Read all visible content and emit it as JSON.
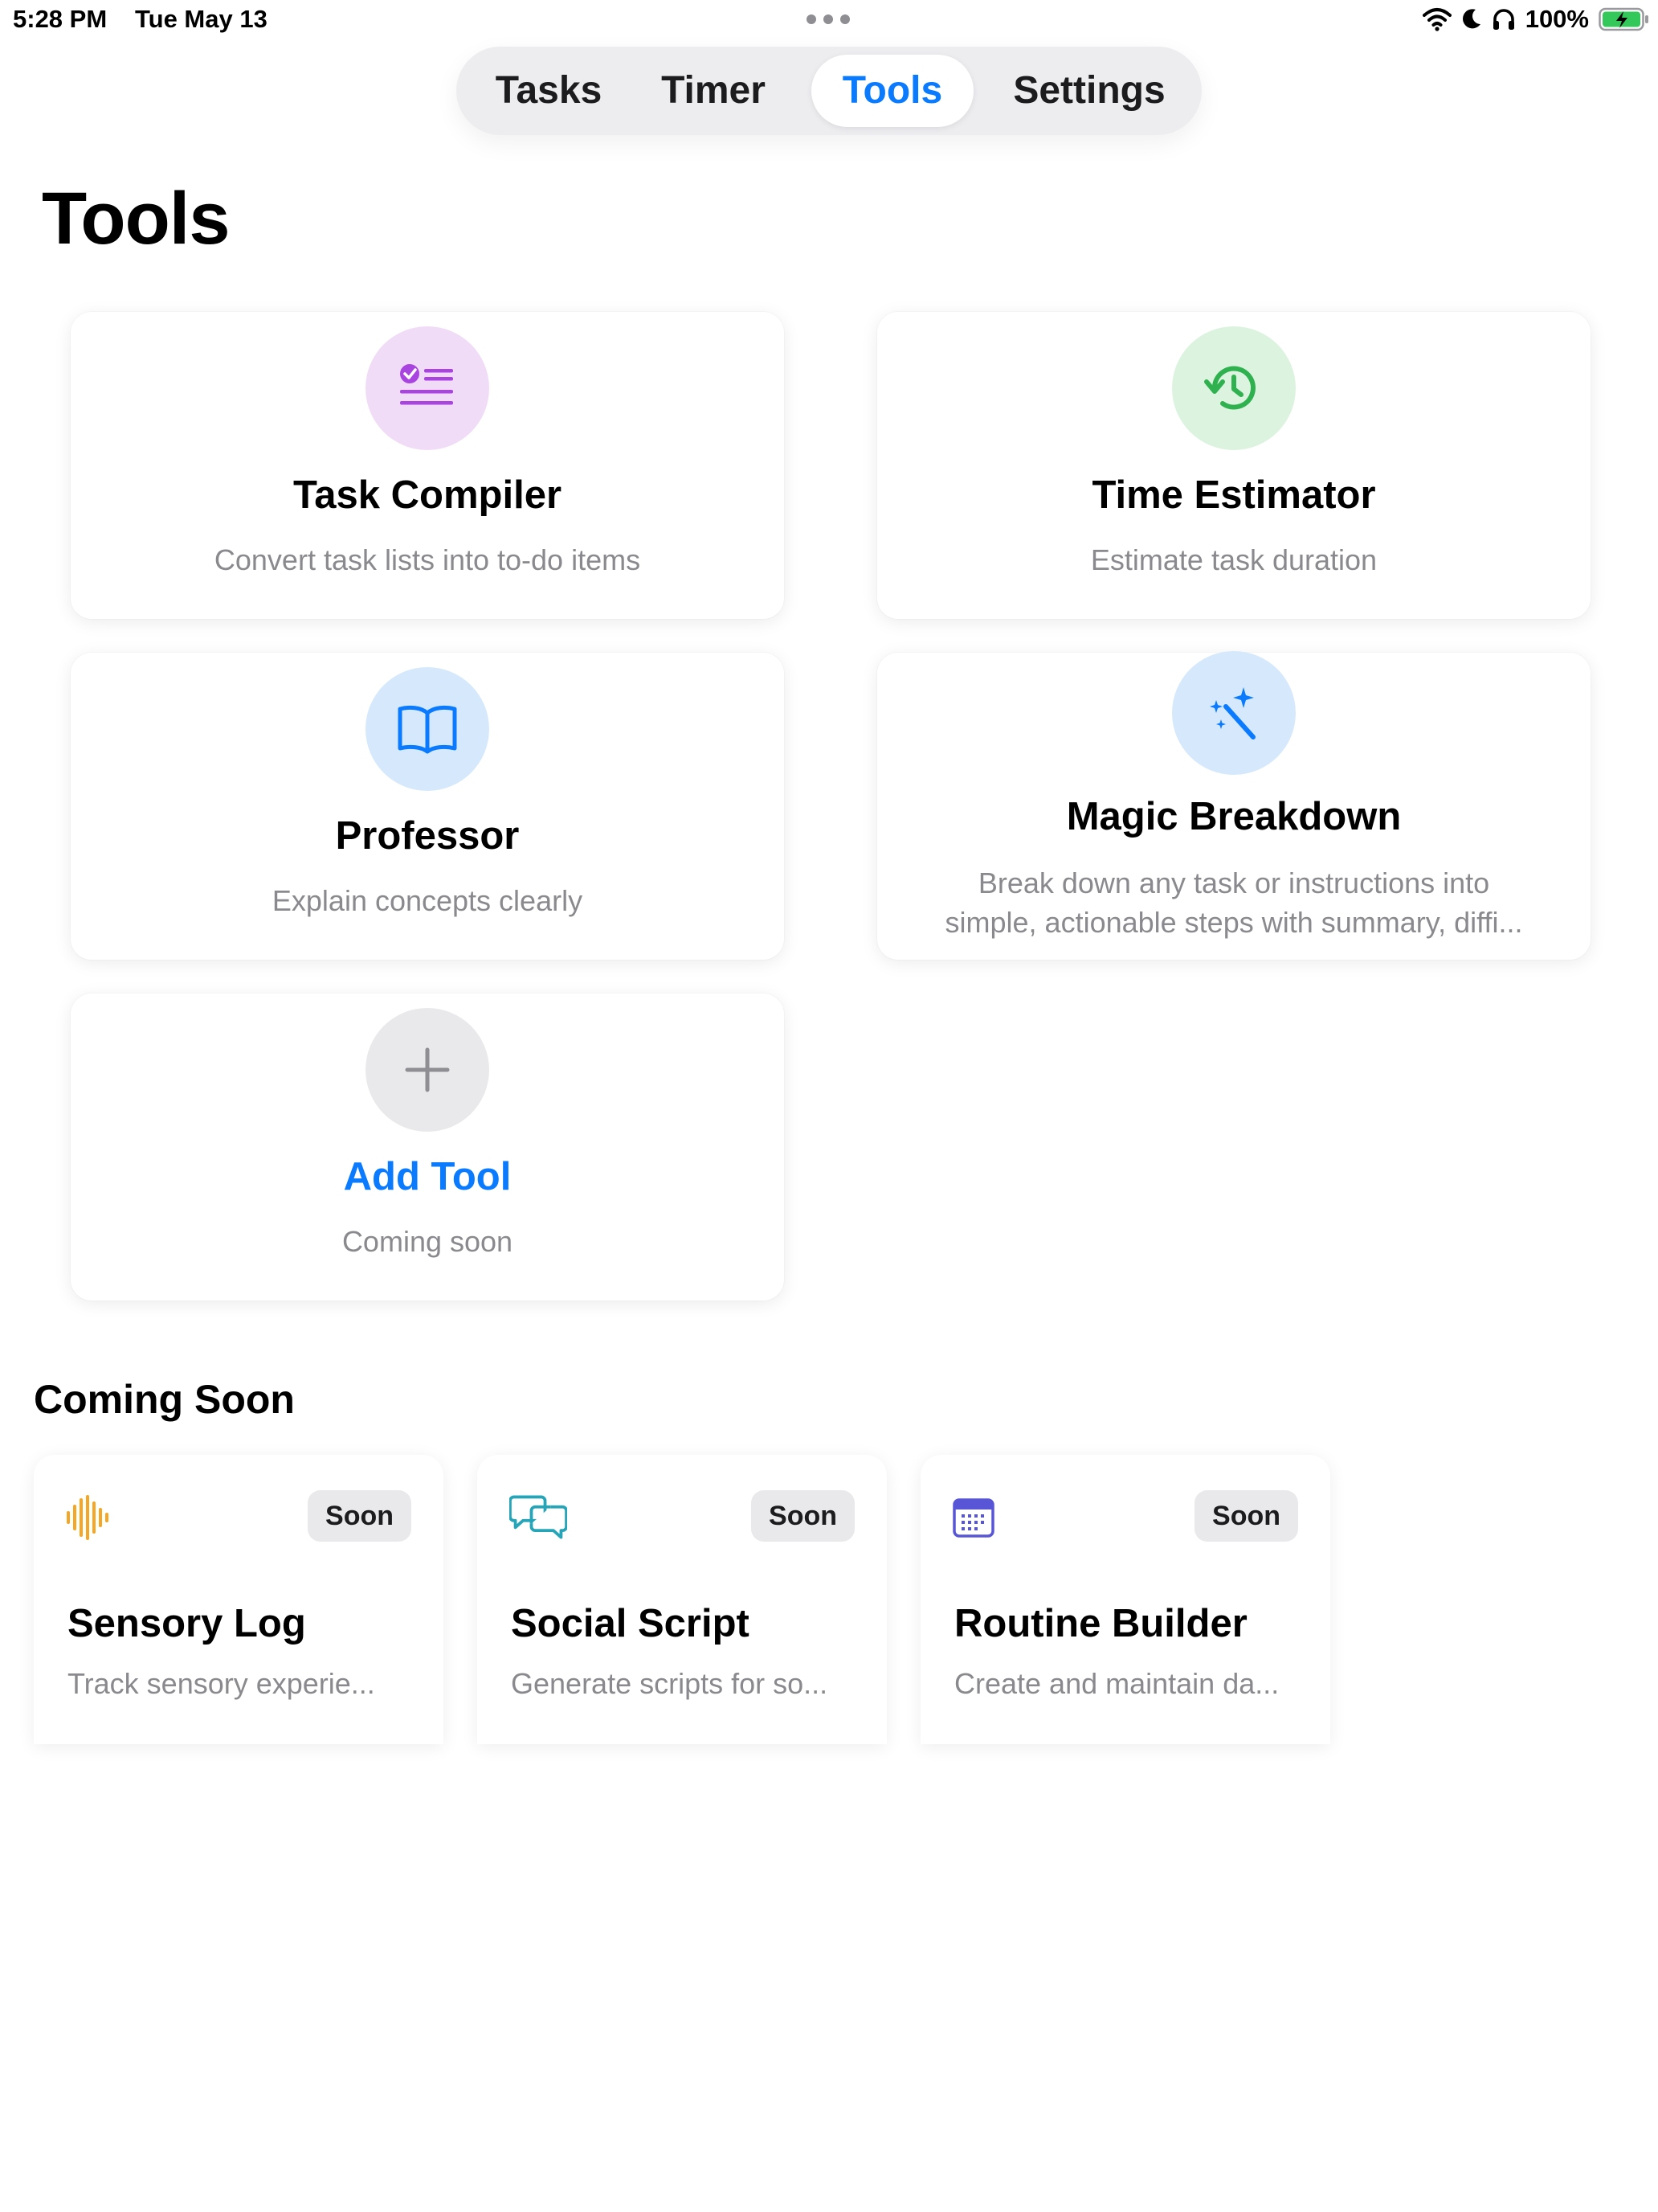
{
  "status_bar": {
    "time": "5:28 PM",
    "date": "Tue May 13",
    "battery_pct": "100%"
  },
  "tabs": [
    {
      "label": "Tasks",
      "active": false
    },
    {
      "label": "Timer",
      "active": false
    },
    {
      "label": "Tools",
      "active": true
    },
    {
      "label": "Settings",
      "active": false
    }
  ],
  "page_title": "Tools",
  "tools": [
    {
      "title": "Task Compiler",
      "desc": "Convert task lists into to-do items",
      "icon": "checklist-icon",
      "icon_color": "#a944e0",
      "icon_bg": "#f1dcf7"
    },
    {
      "title": "Time Estimator",
      "desc": "Estimate task duration",
      "icon": "clock-arrow-icon",
      "icon_color": "#2fb14f",
      "icon_bg": "#dcf3e0"
    },
    {
      "title": "Professor",
      "desc": "Explain concepts clearly",
      "icon": "book-icon",
      "icon_color": "#0a7aff",
      "icon_bg": "#d6e9fc"
    },
    {
      "title": "Magic Breakdown",
      "desc_line1": "Break down any task or instructions into",
      "desc_line2": "simple, actionable steps with summary, diffi...",
      "icon": "magic-wand-icon",
      "icon_color": "#0a7aff",
      "icon_bg": "#d6e9fc"
    },
    {
      "title": "Add Tool",
      "desc": "Coming soon",
      "icon": "plus-icon",
      "icon_color": "#8e8e93",
      "icon_bg": "#e9e9eb",
      "title_color": "#0a7aff"
    }
  ],
  "coming_soon": {
    "title": "Coming Soon",
    "items": [
      {
        "title": "Sensory Log",
        "desc": "Track sensory experie...",
        "badge": "Soon",
        "icon": "waveform-icon",
        "icon_color": "#f5a623"
      },
      {
        "title": "Social Script",
        "desc": "Generate scripts for so...",
        "badge": "Soon",
        "icon": "chat-bubbles-icon",
        "icon_color": "#27a5b8"
      },
      {
        "title": "Routine Builder",
        "desc": "Create and maintain da...",
        "badge": "Soon",
        "icon": "calendar-icon",
        "icon_color": "#5856d6"
      }
    ]
  }
}
